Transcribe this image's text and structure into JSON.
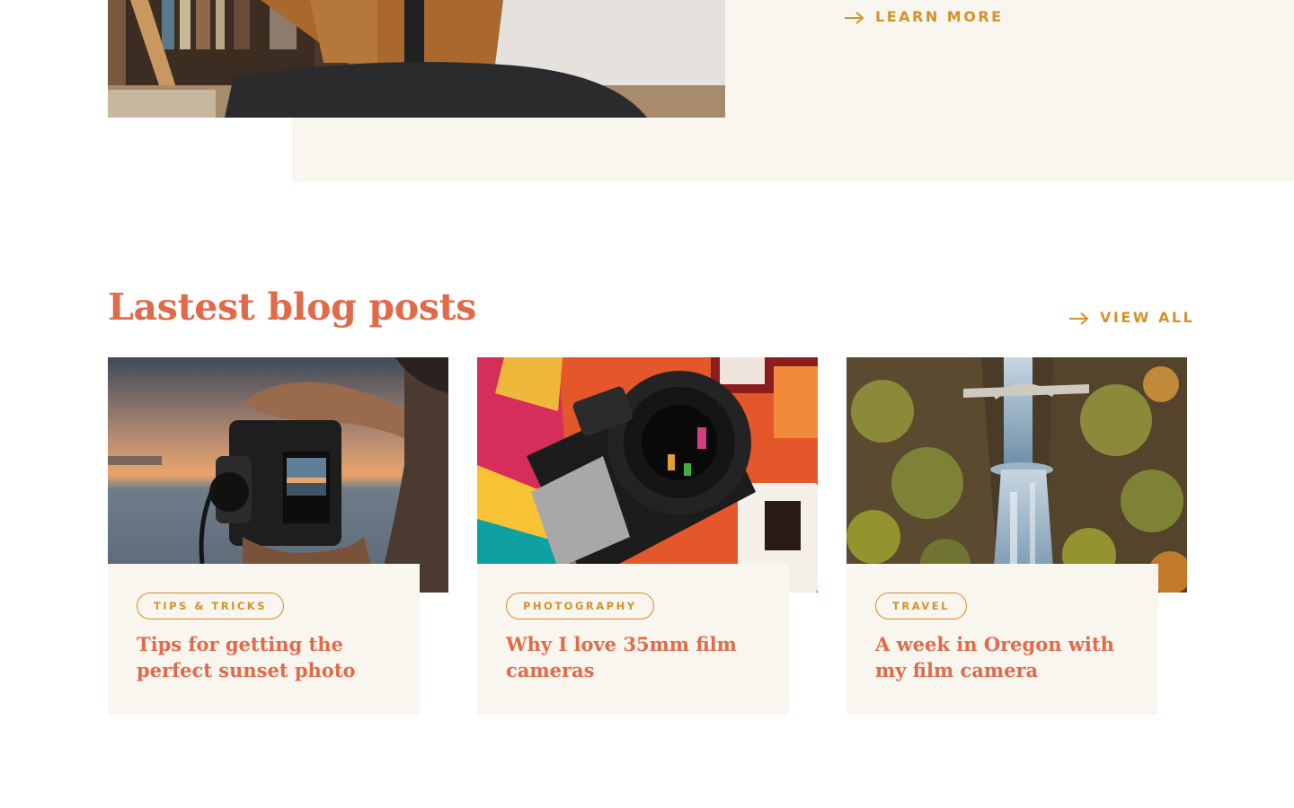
{
  "hero": {
    "learn_more_label": "LEARN MORE",
    "arrow_icon": "arrow-right-icon"
  },
  "blog": {
    "title": "Lastest blog posts",
    "view_all_label": "VIEW ALL",
    "posts": [
      {
        "tag": "TIPS & TRICKS",
        "title": "Tips for getting the perfect sunset photo",
        "image": "person-photographing-sunset-over-water"
      },
      {
        "tag": "PHOTOGRAPHY",
        "title": "Why I love 35mm film cameras",
        "image": "nikon-film-camera-on-colorful-polaroids"
      },
      {
        "tag": "TRAVEL",
        "title": "A week in Oregon with my film camera",
        "image": "waterfall-with-stone-bridge-in-forest"
      }
    ]
  },
  "colors": {
    "accent": "#d4922a",
    "heading": "#e06a4a",
    "panel": "#f9f5ef"
  }
}
